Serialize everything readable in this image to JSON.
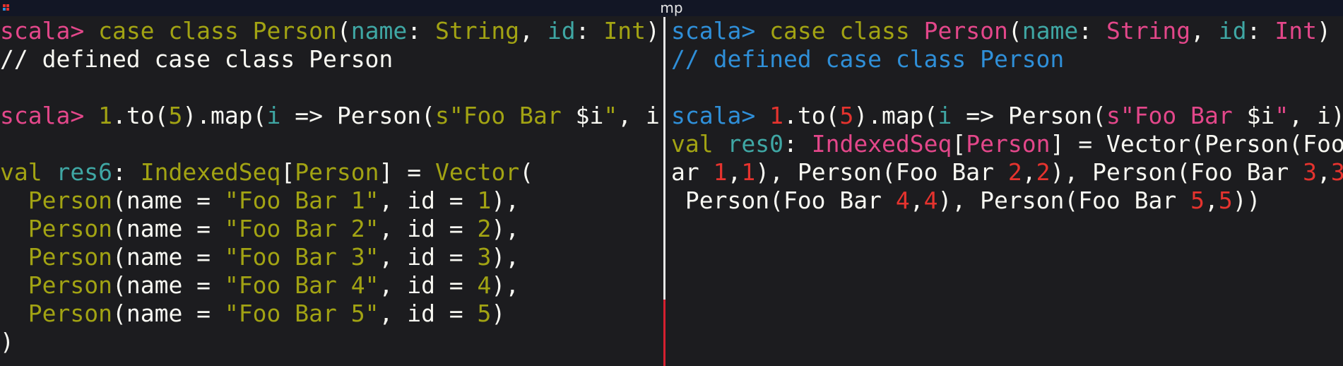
{
  "window": {
    "title": "mp"
  },
  "colors": {
    "background": "#1c1c1f",
    "titlebar": "#121625",
    "default_text": "#f8f8f2",
    "pink_prompt": "#e3478a",
    "olive_keyword": "#a2a313",
    "teal_identifier": "#3fa7a4",
    "blue_prompt": "#2f8fd8",
    "magenta_type": "#e3478a",
    "red_literal": "#e5332e",
    "divider_active": "#e6e6e6",
    "divider_inactive": "#d5202f"
  },
  "panes": {
    "left": {
      "lines": [
        [
          [
            "scala> ",
            "pink"
          ],
          [
            "case class ",
            "olive"
          ],
          [
            "Person",
            "olive"
          ],
          [
            "(",
            "default"
          ],
          [
            "name",
            "teal"
          ],
          [
            ": ",
            "default"
          ],
          [
            "String",
            "olive"
          ],
          [
            ", ",
            "default"
          ],
          [
            "id",
            "teal"
          ],
          [
            ": ",
            "default"
          ],
          [
            "Int",
            "olive"
          ],
          [
            ")",
            "default"
          ]
        ],
        [
          [
            "// defined case class Person",
            "default"
          ]
        ],
        [],
        [
          [
            "scala> ",
            "pink"
          ],
          [
            "1",
            "olive"
          ],
          [
            ".to(",
            "default"
          ],
          [
            "5",
            "olive"
          ],
          [
            ").map(",
            "default"
          ],
          [
            "i",
            "teal"
          ],
          [
            " => Person(",
            "default"
          ],
          [
            "s\"Foo Bar ",
            "olive"
          ],
          [
            "$i",
            "default"
          ],
          [
            "\"",
            "olive"
          ],
          [
            ", i))",
            "default"
          ]
        ],
        [],
        [
          [
            "val ",
            "olive"
          ],
          [
            "res6",
            "teal"
          ],
          [
            ": ",
            "default"
          ],
          [
            "IndexedSeq",
            "olive"
          ],
          [
            "[",
            "default"
          ],
          [
            "Person",
            "olive"
          ],
          [
            "] = ",
            "default"
          ],
          [
            "Vector",
            "olive"
          ],
          [
            "(",
            "default"
          ]
        ],
        [
          [
            "  ",
            "default"
          ],
          [
            "Person",
            "olive"
          ],
          [
            "(name = ",
            "default"
          ],
          [
            "\"Foo Bar 1\"",
            "olive"
          ],
          [
            ", id = ",
            "default"
          ],
          [
            "1",
            "olive"
          ],
          [
            "),",
            "default"
          ]
        ],
        [
          [
            "  ",
            "default"
          ],
          [
            "Person",
            "olive"
          ],
          [
            "(name = ",
            "default"
          ],
          [
            "\"Foo Bar 2\"",
            "olive"
          ],
          [
            ", id = ",
            "default"
          ],
          [
            "2",
            "olive"
          ],
          [
            "),",
            "default"
          ]
        ],
        [
          [
            "  ",
            "default"
          ],
          [
            "Person",
            "olive"
          ],
          [
            "(name = ",
            "default"
          ],
          [
            "\"Foo Bar 3\"",
            "olive"
          ],
          [
            ", id = ",
            "default"
          ],
          [
            "3",
            "olive"
          ],
          [
            "),",
            "default"
          ]
        ],
        [
          [
            "  ",
            "default"
          ],
          [
            "Person",
            "olive"
          ],
          [
            "(name = ",
            "default"
          ],
          [
            "\"Foo Bar 4\"",
            "olive"
          ],
          [
            ", id = ",
            "default"
          ],
          [
            "4",
            "olive"
          ],
          [
            "),",
            "default"
          ]
        ],
        [
          [
            "  ",
            "default"
          ],
          [
            "Person",
            "olive"
          ],
          [
            "(name = ",
            "default"
          ],
          [
            "\"Foo Bar 5\"",
            "olive"
          ],
          [
            ", id = ",
            "default"
          ],
          [
            "5",
            "olive"
          ],
          [
            ")",
            "default"
          ]
        ],
        [
          [
            ")",
            "default"
          ]
        ]
      ]
    },
    "right": {
      "lines": [
        [
          [
            "scala> ",
            "blue"
          ],
          [
            "case class ",
            "olive"
          ],
          [
            "Person",
            "magenta"
          ],
          [
            "(",
            "default"
          ],
          [
            "name",
            "teal"
          ],
          [
            ": ",
            "default"
          ],
          [
            "String",
            "magenta"
          ],
          [
            ", ",
            "default"
          ],
          [
            "id",
            "teal"
          ],
          [
            ": ",
            "default"
          ],
          [
            "Int",
            "magenta"
          ],
          [
            ")",
            "default"
          ]
        ],
        [
          [
            "// defined case class Person",
            "blue"
          ]
        ],
        [],
        [
          [
            "scala> ",
            "blue"
          ],
          [
            "1",
            "red"
          ],
          [
            ".to(",
            "default"
          ],
          [
            "5",
            "red"
          ],
          [
            ").map(",
            "default"
          ],
          [
            "i",
            "teal"
          ],
          [
            " => Person(",
            "default"
          ],
          [
            "s\"Foo Bar ",
            "magenta"
          ],
          [
            "$i",
            "default"
          ],
          [
            "\"",
            "magenta"
          ],
          [
            ", i))",
            "default"
          ]
        ],
        [
          [
            "val ",
            "olive"
          ],
          [
            "res0",
            "teal"
          ],
          [
            ": ",
            "default"
          ],
          [
            "IndexedSeq",
            "magenta"
          ],
          [
            "[",
            "default"
          ],
          [
            "Person",
            "magenta"
          ],
          [
            "] = Vector(Person(Foo B",
            "default"
          ]
        ],
        [
          [
            "ar ",
            "default"
          ],
          [
            "1",
            "red"
          ],
          [
            ",",
            "default"
          ],
          [
            "1",
            "red"
          ],
          [
            "), Person(Foo Bar ",
            "default"
          ],
          [
            "2",
            "red"
          ],
          [
            ",",
            "default"
          ],
          [
            "2",
            "red"
          ],
          [
            "), Person(Foo Bar ",
            "default"
          ],
          [
            "3",
            "red"
          ],
          [
            ",",
            "default"
          ],
          [
            "3",
            "red"
          ],
          [
            "),",
            "default"
          ]
        ],
        [
          [
            " Person(Foo Bar ",
            "default"
          ],
          [
            "4",
            "red"
          ],
          [
            ",",
            "default"
          ],
          [
            "4",
            "red"
          ],
          [
            "), Person(Foo Bar ",
            "default"
          ],
          [
            "5",
            "red"
          ],
          [
            ",",
            "default"
          ],
          [
            "5",
            "red"
          ],
          [
            "))",
            "default"
          ]
        ]
      ]
    }
  }
}
